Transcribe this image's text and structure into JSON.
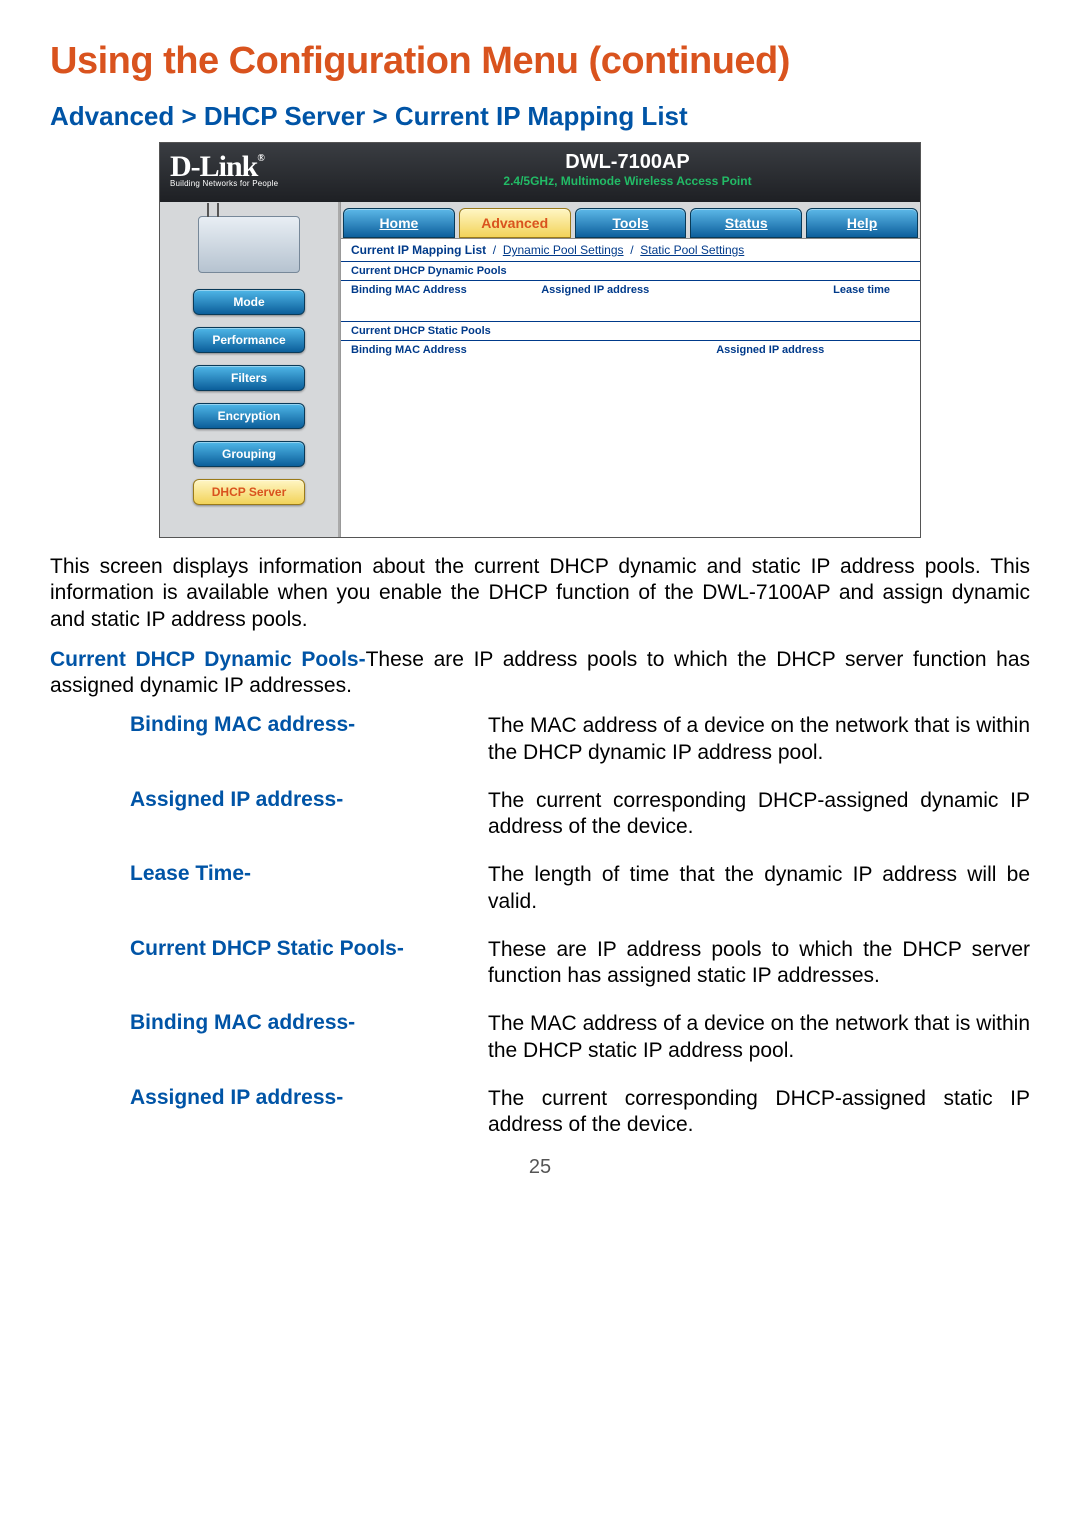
{
  "page_title": "Using the Configuration Menu (continued)",
  "breadcrumb": "Advanced > DHCP Server > Current IP Mapping List",
  "router": {
    "brand": "D-Link",
    "brand_reg": "®",
    "brand_tagline": "Building Networks for People",
    "model": "DWL-7100AP",
    "model_sub": "2.4/5GHz, Multimode Wireless Access Point",
    "tabs": {
      "home": "Home",
      "advanced": "Advanced",
      "tools": "Tools",
      "status": "Status",
      "help": "Help"
    },
    "sublinks": {
      "current": "Current IP Mapping List",
      "dynamic": "Dynamic Pool Settings",
      "static": "Static Pool Settings",
      "sep": "/"
    },
    "side": {
      "mode": "Mode",
      "performance": "Performance",
      "filters": "Filters",
      "encryption": "Encryption",
      "grouping": "Grouping",
      "dhcp": "DHCP Server"
    },
    "sections": {
      "dyn_title": "Current DHCP Dynamic Pools",
      "dyn_cols": {
        "mac": "Binding MAC Address",
        "ip": "Assigned IP address",
        "lease": "Lease time"
      },
      "stat_title": "Current DHCP Static Pools",
      "stat_cols": {
        "mac": "Binding MAC Address",
        "ip": "Assigned IP address"
      }
    }
  },
  "intro": "This screen displays information about the current DHCP dynamic and static IP address pools. This information is available when you enable the DHCP function of the DWL-7100AP and assign dynamic and static IP address pools.",
  "dyn_pools_label": "Current DHCP Dynamic Pools-",
  "dyn_pools_text": "These are IP address pools to which the DHCP server function has assigned dynamic IP addresses.",
  "defs": [
    {
      "label": "Binding MAC address-",
      "text": "The MAC address of a device on the network that is within the DHCP dynamic IP address pool."
    },
    {
      "label": "Assigned IP address-",
      "text": "The current corresponding DHCP-assigned dynamic IP address of the device."
    },
    {
      "label": "Lease Time-",
      "text": "The length of time that the dynamic IP address will be valid."
    },
    {
      "label": "Current DHCP Static Pools-",
      "text": "These are IP address pools to which the DHCP server function has assigned static IP addresses."
    },
    {
      "label": "Binding MAC address-",
      "text": "The MAC address of a device on the network that is within the DHCP static IP address pool."
    },
    {
      "label": "Assigned IP address-",
      "text": "The current corresponding DHCP-assigned static IP address of the device."
    }
  ],
  "page_number": "25"
}
